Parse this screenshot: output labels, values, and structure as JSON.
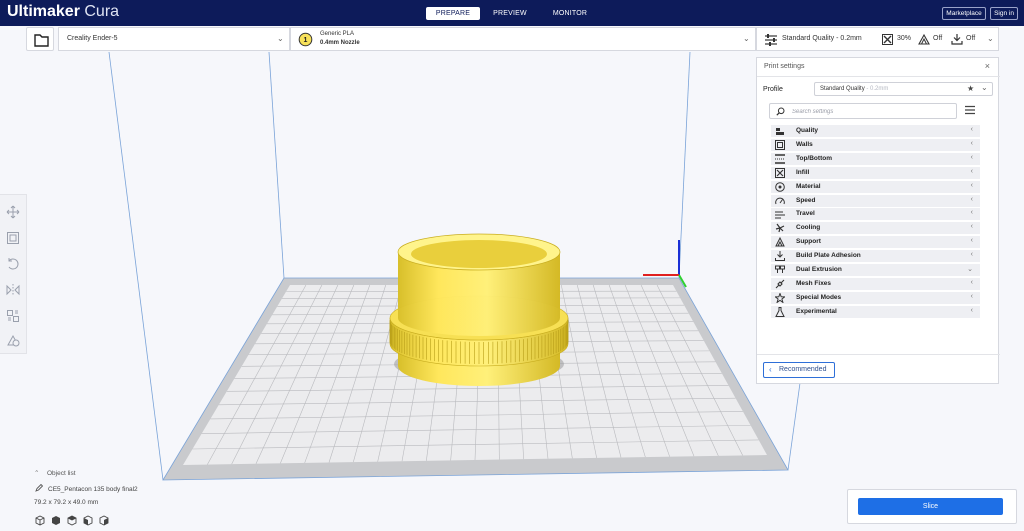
{
  "app": {
    "brand_bold": "Ultimaker",
    "brand_light": "Cura"
  },
  "stages": [
    {
      "label": "PREPARE",
      "active": true
    },
    {
      "label": "PREVIEW",
      "active": false
    },
    {
      "label": "MONITOR",
      "active": false
    }
  ],
  "top_buttons": {
    "marketplace": "Marketplace",
    "sign_in": "Sign in"
  },
  "printer": {
    "name": "Creality Ender-5"
  },
  "material": {
    "extruder_number": "1",
    "name": "Generic PLA",
    "nozzle": "0.4mm Nozzle"
  },
  "quality_bar": {
    "profile": "Standard Quality - 0.2mm",
    "infill": "30%",
    "support": "Off",
    "adhesion": "Off"
  },
  "print_settings": {
    "title": "Print settings",
    "profile_label": "Profile",
    "profile_value": "Standard Quality",
    "profile_sub": "- 0.2mm",
    "search_placeholder": "Search settings",
    "categories": [
      {
        "label": "Quality",
        "icon": "quality-icon",
        "expanded": false
      },
      {
        "label": "Walls",
        "icon": "walls-icon",
        "expanded": false
      },
      {
        "label": "Top/Bottom",
        "icon": "top-bottom-icon",
        "expanded": false
      },
      {
        "label": "Infill",
        "icon": "infill-icon",
        "expanded": false
      },
      {
        "label": "Material",
        "icon": "material-icon",
        "expanded": false
      },
      {
        "label": "Speed",
        "icon": "speed-icon",
        "expanded": false
      },
      {
        "label": "Travel",
        "icon": "travel-icon",
        "expanded": false
      },
      {
        "label": "Cooling",
        "icon": "cooling-icon",
        "expanded": false
      },
      {
        "label": "Support",
        "icon": "support-icon",
        "expanded": false
      },
      {
        "label": "Build Plate Adhesion",
        "icon": "adhesion-icon",
        "expanded": false
      },
      {
        "label": "Dual Extrusion",
        "icon": "dual-extrusion-icon",
        "expanded": true
      },
      {
        "label": "Mesh Fixes",
        "icon": "mesh-fixes-icon",
        "expanded": false
      },
      {
        "label": "Special Modes",
        "icon": "special-modes-icon",
        "expanded": false
      },
      {
        "label": "Experimental",
        "icon": "experimental-icon",
        "expanded": false
      }
    ],
    "recommended_label": "Recommended"
  },
  "object_list": {
    "header": "Object list",
    "object_name": "CE5_Pentacon 135 body final2",
    "dimensions": "79.2 x 79.2 x 49.0 mm"
  },
  "slice": {
    "label": "Slice"
  },
  "colors": {
    "header_bg": "#0d1b5a",
    "accent_blue": "#1e6fe6",
    "model_yellow": "#ffe85a"
  }
}
